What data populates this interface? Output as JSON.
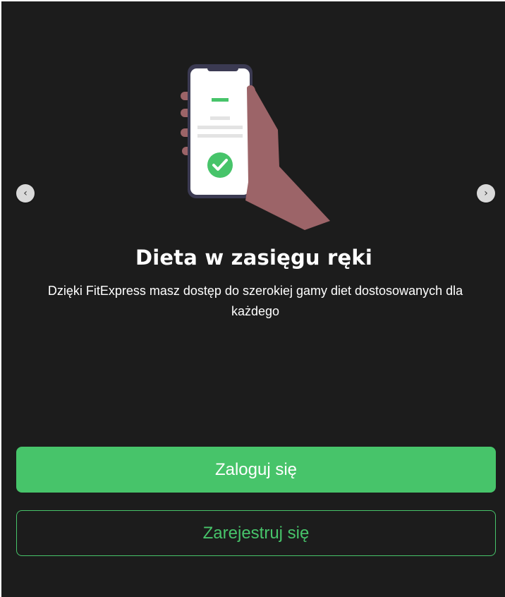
{
  "slide": {
    "title": "Dieta w zasięgu ręki",
    "description": "Dzięki FitExpress masz dostęp do szerokiej gamy diet dostosowanych dla każdego",
    "illustration_icon": "hand-holding-phone-with-checkmark-icon"
  },
  "carousel": {
    "prev_label": "‹",
    "next_label": "›"
  },
  "actions": {
    "login_label": "Zaloguj się",
    "register_label": "Zarejestruj się"
  },
  "colors": {
    "background": "#1c1c1c",
    "accent": "#47c46a",
    "hand": "#9c6468",
    "phone_frame": "#3b3a52"
  }
}
